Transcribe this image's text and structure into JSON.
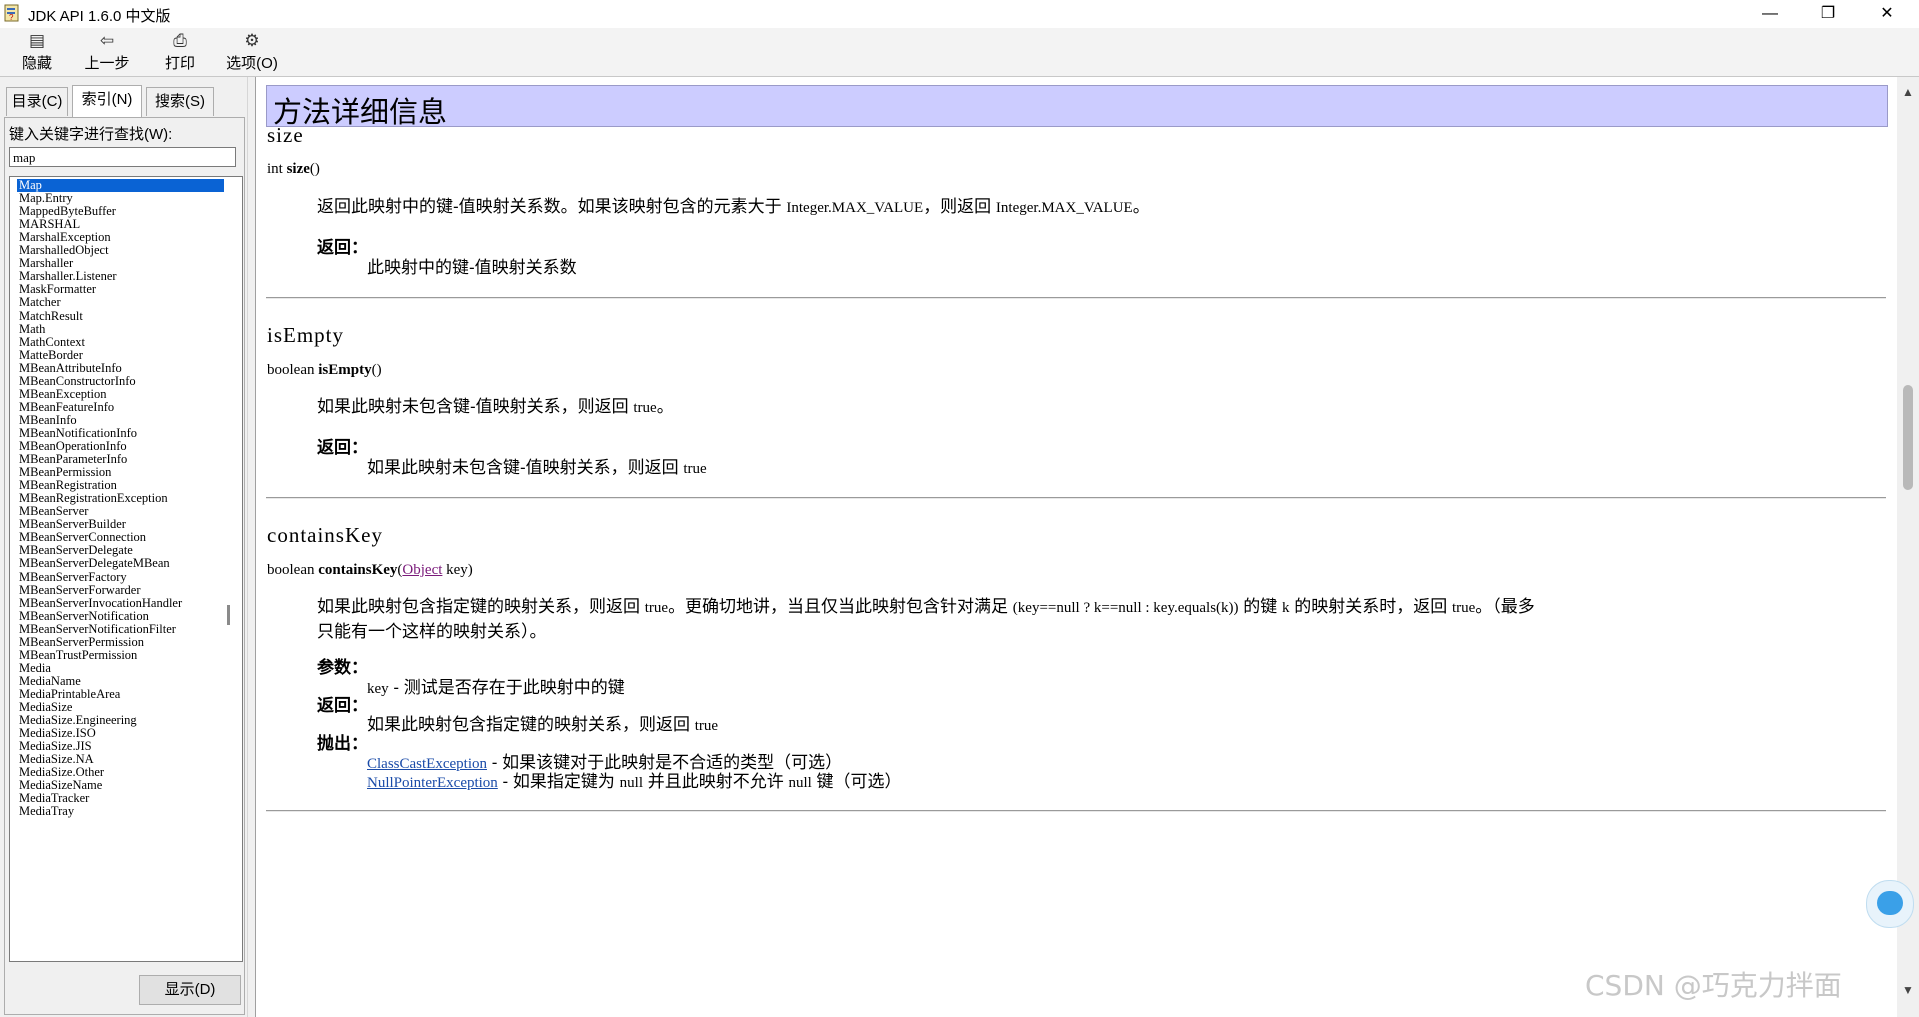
{
  "window": {
    "title": "JDK API 1.6.0 中文版",
    "minimize": "—",
    "restore": "❐",
    "close": "✕"
  },
  "toolbar": {
    "hide": "隐藏",
    "back": "上一步",
    "print": "打印",
    "options": "选项(O)"
  },
  "left": {
    "tabs": [
      "目录(C)",
      "索引(N)",
      "搜索(S)"
    ],
    "keyword_label": "键入关键字进行查找(W):",
    "keyword_value": "map",
    "show_button": "显示(D)",
    "items": [
      "Map",
      "Map.Entry",
      "MappedByteBuffer",
      "MARSHAL",
      "MarshalException",
      "MarshalledObject",
      "Marshaller",
      "Marshaller.Listener",
      "MaskFormatter",
      "Matcher",
      "MatchResult",
      "Math",
      "MathContext",
      "MatteBorder",
      "MBeanAttributeInfo",
      "MBeanConstructorInfo",
      "MBeanException",
      "MBeanFeatureInfo",
      "MBeanInfo",
      "MBeanNotificationInfo",
      "MBeanOperationInfo",
      "MBeanParameterInfo",
      "MBeanPermission",
      "MBeanRegistration",
      "MBeanRegistrationException",
      "MBeanServer",
      "MBeanServerBuilder",
      "MBeanServerConnection",
      "MBeanServerDelegate",
      "MBeanServerDelegateMBean",
      "MBeanServerFactory",
      "MBeanServerForwarder",
      "MBeanServerInvocationHandler",
      "MBeanServerNotification",
      "MBeanServerNotificationFilter",
      "MBeanServerPermission",
      "MBeanTrustPermission",
      "Media",
      "MediaName",
      "MediaPrintableArea",
      "MediaSize",
      "MediaSize.Engineering",
      "MediaSize.ISO",
      "MediaSize.JIS",
      "MediaSize.NA",
      "MediaSize.Other",
      "MediaSizeName",
      "MediaTracker",
      "MediaTray"
    ]
  },
  "content": {
    "section_title": "方法详细信息",
    "returns_label": "返回：",
    "params_label": "参数：",
    "throws_label": "抛出：",
    "size": {
      "name": "size",
      "sig_type": "int ",
      "sig_name": "size",
      "sig_args": "()",
      "desc_a": "返回此映射中的键-值映射关系数。如果该映射包含的元素大于 ",
      "desc_code1": "Integer.MAX_VALUE",
      "desc_b": "，则返回 ",
      "desc_code2": "Integer.MAX_VALUE",
      "desc_c": "。",
      "returns": "此映射中的键-值映射关系数"
    },
    "isEmpty": {
      "name": "isEmpty",
      "sig_type": "boolean ",
      "sig_name": "isEmpty",
      "sig_args": "()",
      "desc_a": "如果此映射未包含键-值映射关系，则返回 ",
      "desc_code": "true",
      "desc_b": "。",
      "returns_a": "如果此映射未包含键-值映射关系，则返回 ",
      "returns_code": "true"
    },
    "containsKey": {
      "name": "containsKey",
      "sig_type": "boolean ",
      "sig_name": "containsKey",
      "sig_open": "(",
      "sig_param_type": "Object",
      "sig_rest": " key)",
      "desc_a": "如果此映射包含指定键的映射关系，则返回 ",
      "desc_code1": "true",
      "desc_b": "。更确切地讲，当且仅当此映射包含针对满足 ",
      "desc_code2": "(key==null ? k==null : key.equals(k))",
      "desc_c": " 的键 ",
      "desc_code3": "k",
      "desc_d": " 的映射关系时，返回 ",
      "desc_code4": "true",
      "desc_e": "。（最多",
      "desc_line2": "只能有一个这样的映射关系）。",
      "param_code": "key",
      "param_text": " - 测试是否存在于此映射中的键",
      "returns_a": "如果此映射包含指定键的映射关系，则返回 ",
      "returns_code": "true",
      "throws1_link": "ClassCastException",
      "throws1_text": " - 如果该键对于此映射是不合适的类型（可选）",
      "throws2_link": "NullPointerException",
      "throws2_text_a": " - 如果指定键为 ",
      "throws2_code1": "null",
      "throws2_text_b": " 并且此映射不允许 ",
      "throws2_code2": "null",
      "throws2_text_c": " 键（可选）"
    }
  },
  "watermark": "CSDN @巧克力拌面"
}
